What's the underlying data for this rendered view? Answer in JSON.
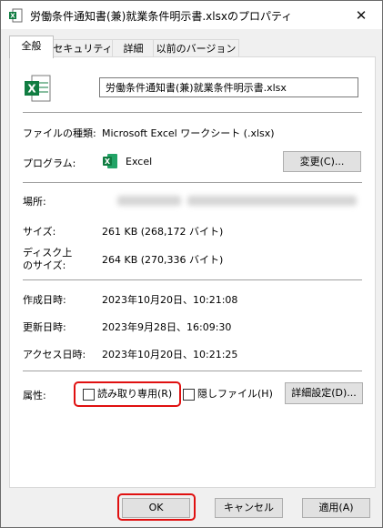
{
  "window": {
    "title": "労働条件通知書(兼)就業条件明示書.xlsxのプロパティ",
    "close_glyph": "✕"
  },
  "tabs": [
    {
      "label": "全般"
    },
    {
      "label": "セキュリティ"
    },
    {
      "label": "詳細"
    },
    {
      "label": "以前のバージョン"
    }
  ],
  "general": {
    "filename": "労働条件通知書(兼)就業条件明示書.xlsx",
    "file_type_label": "ファイルの種類:",
    "file_type_value": "Microsoft Excel ワークシート (.xlsx)",
    "program_label": "プログラム:",
    "program_value": "Excel",
    "change_button": "変更(C)...",
    "location_label": "場所:",
    "size_label": "サイズ:",
    "size_value": "261 KB (268,172 バイト)",
    "disk_size_label_line1": "ディスク上",
    "disk_size_label_line2": "のサイズ:",
    "disk_size_value": "264 KB (270,336 バイト)",
    "created_label": "作成日時:",
    "created_value": "2023年10月20日、10:21:08",
    "modified_label": "更新日時:",
    "modified_value": "2023年9月28日、16:09:30",
    "accessed_label": "アクセス日時:",
    "accessed_value": "2023年10月20日、10:21:25",
    "attributes_label": "属性:",
    "readonly_label": "読み取り専用(R)",
    "hidden_label": "隠しファイル(H)",
    "advanced_button": "詳細設定(D)..."
  },
  "footer": {
    "ok": "OK",
    "cancel": "キャンセル",
    "apply": "適用(A)"
  },
  "colors": {
    "excel_green": "#107c41",
    "highlight_red": "#e01010",
    "tab_bg": "#ffffff"
  }
}
